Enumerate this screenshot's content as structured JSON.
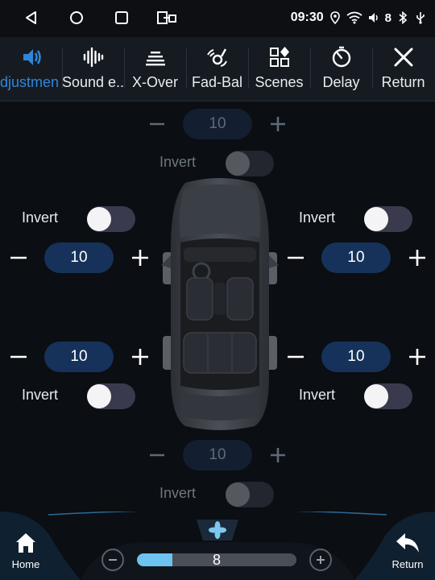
{
  "statusbar": {
    "time": "09:30",
    "volume_level": "8"
  },
  "tabs": [
    {
      "label": "djustmen",
      "icon": "speaker-icon",
      "active": true
    },
    {
      "label": "Sound e..",
      "icon": "waveform-icon",
      "active": false
    },
    {
      "label": "X-Over",
      "icon": "equalizer-icon",
      "active": false
    },
    {
      "label": "Fad-Bal",
      "icon": "fader-balance-icon",
      "active": false
    },
    {
      "label": "Scenes",
      "icon": "scenes-grid-icon",
      "active": false
    },
    {
      "label": "Delay",
      "icon": "timer-icon",
      "active": false
    },
    {
      "label": "Return",
      "icon": "close-icon",
      "active": false
    }
  ],
  "speakers": {
    "front_center": {
      "value": "10",
      "invert_label": "Invert",
      "invert_on": false,
      "enabled": false
    },
    "front_left": {
      "value": "10",
      "invert_label": "Invert",
      "invert_on": false,
      "enabled": true
    },
    "front_right": {
      "value": "10",
      "invert_label": "Invert",
      "invert_on": false,
      "enabled": true
    },
    "rear_left": {
      "value": "10",
      "invert_label": "Invert",
      "invert_on": false,
      "enabled": true
    },
    "rear_right": {
      "value": "10",
      "invert_label": "Invert",
      "invert_on": false,
      "enabled": true
    },
    "subwoofer": {
      "value": "10",
      "invert_label": "Invert",
      "invert_on": false,
      "enabled": false
    }
  },
  "bottom": {
    "home_label": "Home",
    "return_label": "Return",
    "volume_value": "8",
    "volume_fraction": 0.22,
    "accent_color": "#6cc3f0"
  }
}
